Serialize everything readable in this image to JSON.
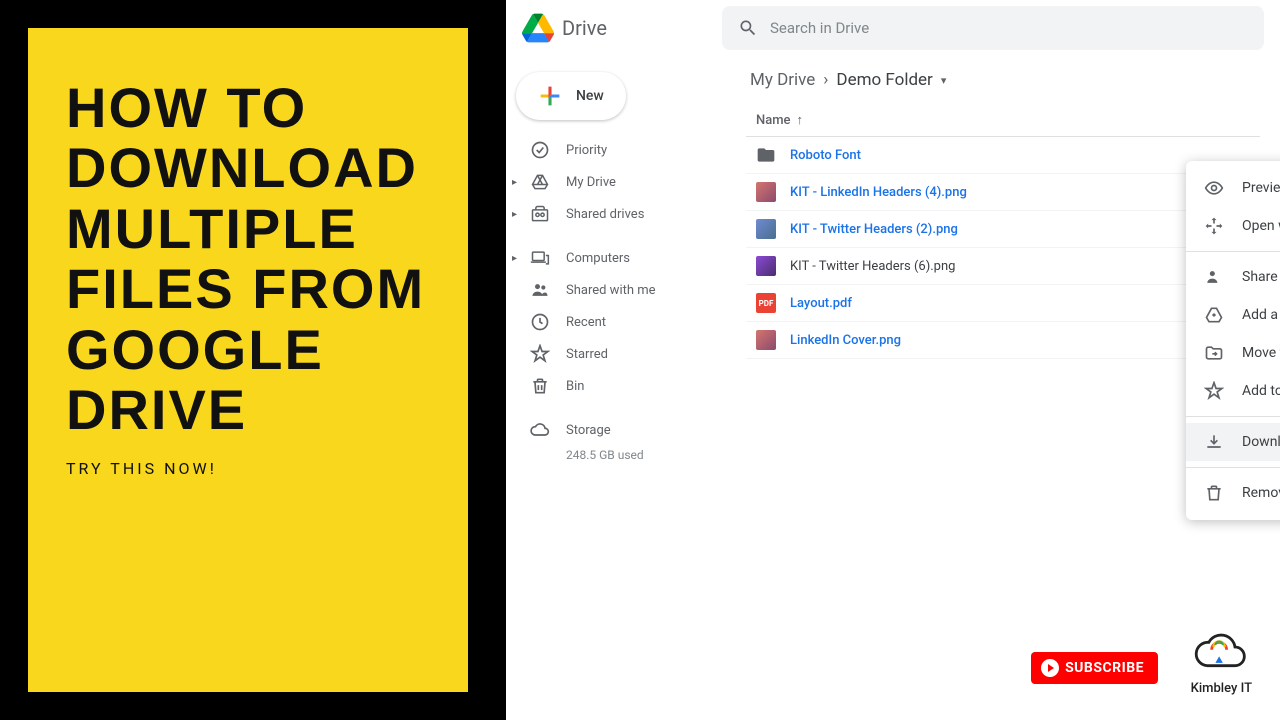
{
  "promo": {
    "title": "HOW TO DOWNLOAD MULTIPLE FILES FROM GOOGLE DRIVE",
    "subtitle": "TRY THIS NOW!"
  },
  "header": {
    "app_name": "Drive",
    "search_placeholder": "Search in Drive"
  },
  "sidebar": {
    "new_label": "New",
    "items": [
      {
        "label": "Priority",
        "icon": "check-circle"
      },
      {
        "label": "My Drive",
        "icon": "drive",
        "expandable": true
      },
      {
        "label": "Shared drives",
        "icon": "shared-drives",
        "expandable": true
      },
      {
        "label": "Computers",
        "icon": "computers",
        "expandable": true
      },
      {
        "label": "Shared with me",
        "icon": "people"
      },
      {
        "label": "Recent",
        "icon": "clock"
      },
      {
        "label": "Starred",
        "icon": "star"
      },
      {
        "label": "Bin",
        "icon": "trash"
      },
      {
        "label": "Storage",
        "icon": "cloud"
      }
    ],
    "storage_used": "248.5 GB used"
  },
  "breadcrumb": {
    "root": "My Drive",
    "current": "Demo Folder"
  },
  "column_header": "Name",
  "files": [
    {
      "name": "Roboto Font",
      "type": "folder",
      "selected": true
    },
    {
      "name": "KIT - LinkedIn Headers (4).png",
      "type": "image",
      "selected": true
    },
    {
      "name": "KIT - Twitter Headers (2).png",
      "type": "image",
      "selected": true
    },
    {
      "name": "KIT - Twitter Headers (6).png",
      "type": "image",
      "selected": false
    },
    {
      "name": "Layout.pdf",
      "type": "pdf",
      "selected": true
    },
    {
      "name": "LinkedIn Cover.png",
      "type": "image",
      "selected": true
    }
  ],
  "context_menu": {
    "items": [
      {
        "label": "Preview",
        "icon": "eye"
      },
      {
        "label": "Open with",
        "icon": "open-with",
        "arrow": true
      },
      {
        "divider": true
      },
      {
        "label": "Share",
        "icon": "person-add"
      },
      {
        "label": "Add a shortcut to Drive",
        "icon": "shortcut",
        "help": true
      },
      {
        "label": "Move to",
        "icon": "move"
      },
      {
        "label": "Add to Starred",
        "icon": "star"
      },
      {
        "divider": true
      },
      {
        "label": "Download",
        "icon": "download",
        "highlighted": true
      },
      {
        "divider": true
      },
      {
        "label": "Remove",
        "icon": "trash"
      }
    ]
  },
  "subscribe": {
    "label": "SUBSCRIBE"
  },
  "brand": {
    "name": "Kimbley IT"
  }
}
